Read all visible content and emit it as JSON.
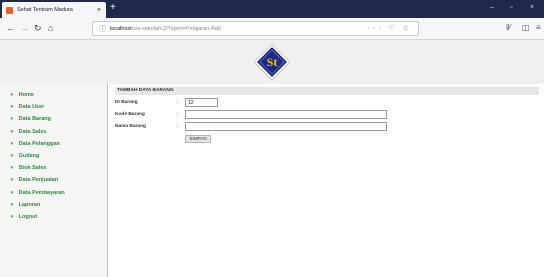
{
  "browser": {
    "tab_title": "Sehat Tentram Madura",
    "tab_close": "×",
    "new_tab": "+",
    "url_host": "localhost",
    "url_path": "/sia-sekolah-2/?open=Pelajaran-Add",
    "url_actions": "··· ♡ ☆",
    "win_minimize": "–",
    "win_maximize": "▫",
    "win_close": "×"
  },
  "banner": {
    "logo_text": "St"
  },
  "sidebar": {
    "items": [
      {
        "label": "Home"
      },
      {
        "label": "Data User"
      },
      {
        "label": "Data Barang"
      },
      {
        "label": "Data Sales"
      },
      {
        "label": "Data Pelanggan"
      },
      {
        "label": "Gudang"
      },
      {
        "label": "Stok Sales"
      },
      {
        "label": "Data Penjualan"
      },
      {
        "label": "Data Pembayaran"
      },
      {
        "label": "Laporan"
      },
      {
        "label": "Logout"
      }
    ]
  },
  "form": {
    "title": "TAMBAH DATA BARANG",
    "colon": ":",
    "fields": [
      {
        "label": "ID Barang",
        "value": "12"
      },
      {
        "label": "Kode Barang",
        "value": ""
      },
      {
        "label": "Nama Barang",
        "value": ""
      }
    ],
    "submit_label": "SIMPAN"
  },
  "colors": {
    "menu_text": "#2f8a3d",
    "tabbar": "#1f2a4a",
    "logo_bg": "#1c2a86",
    "logo_text": "#f3d21b"
  }
}
